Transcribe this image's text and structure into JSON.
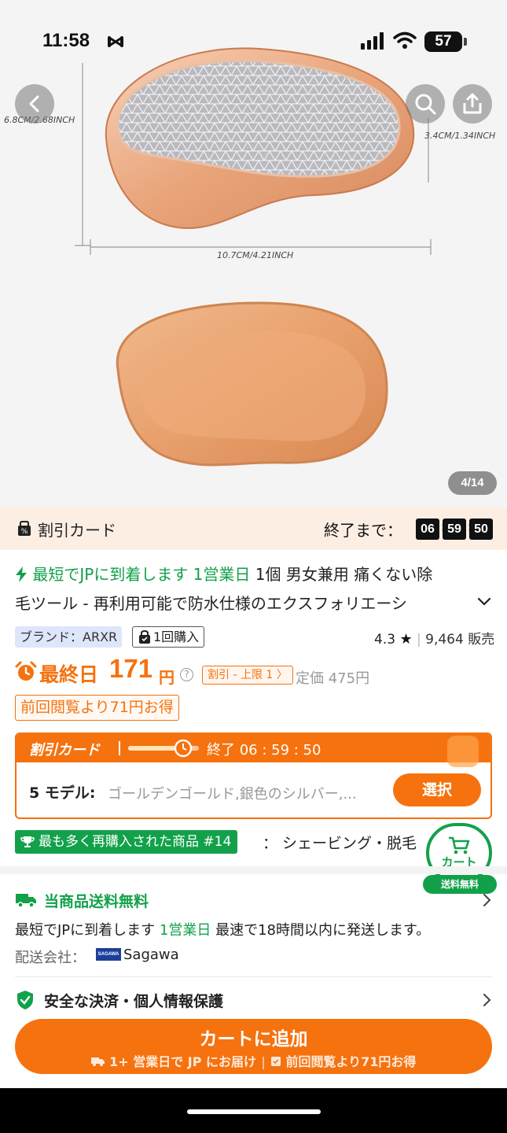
{
  "status_bar": {
    "time": "11:58",
    "battery": "57"
  },
  "gallery": {
    "page_indicator": "4/14",
    "dimensions": {
      "width_label": "10.7CM/4.21INCH",
      "height_label": "6.8CM/2.68INCH",
      "depth_label": "3.4CM/1.34INCH"
    }
  },
  "discount_bar": {
    "label": "割引カード",
    "ends_label": "終了まで：",
    "hours": "06",
    "minutes": "59",
    "seconds": "50"
  },
  "product": {
    "delivery_highlight": "最短でJPに到着します 1営業日",
    "title_part1": " 1個 男女兼用 痛くない除",
    "title_line2": "毛ツール - 再利用可能で防水仕様のエクスフォリエーシ",
    "brand": "ブランド：ARXR",
    "bought": "1回購入",
    "rating": "4.3",
    "sales": "9,464 販売"
  },
  "price": {
    "prefix": "最終日",
    "value": "171",
    "unit": "円",
    "help": "?",
    "limit_badge": "割引 - 上限 1 〉",
    "list_price": "定価 475円",
    "saving": "前回閲覧より71円お得"
  },
  "coupon": {
    "title": "割引カード",
    "ends": "終了  06 : 59 : 50",
    "progress": 0.7,
    "model_label": "5 モデル:",
    "model_options": "ゴールデンゴールド,銀色のシルバー,...",
    "select_button": "選択"
  },
  "rank": {
    "badge": "最も多く再購入された商品 #14",
    "category": "：  シェービング・脱毛"
  },
  "floating_cart": {
    "label": "カート",
    "free_shipping": "送料無料"
  },
  "shipping": {
    "free_label": "当商品送料無料",
    "detail_prefix": "最短でJPに到着します ",
    "detail_days": "1営業日",
    "detail_suffix": " 最速で18時間以内に発送します。",
    "carrier_label": "配送会社：",
    "carrier_logo": "SAGAWA",
    "carrier_name": "Sagawa"
  },
  "secure": {
    "label": "安全な決済・個人情報保護"
  },
  "cta": {
    "add_to_cart": "カートに追加",
    "sub_left": "1+ 営業日で JP にお届け",
    "sub_right": "前回閲覧より71円お得"
  },
  "colors": {
    "accent": "#f5720f",
    "green": "#12a14a",
    "discount_bg": "#fdeee3"
  }
}
